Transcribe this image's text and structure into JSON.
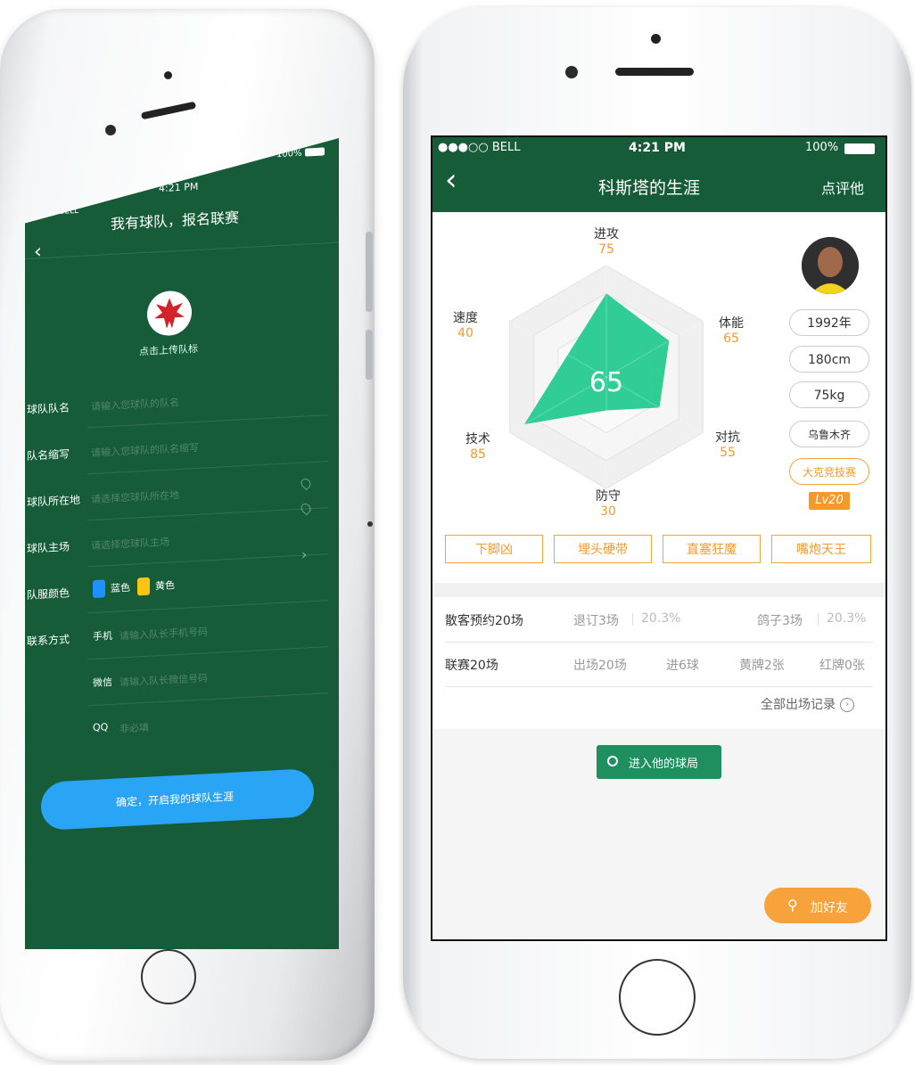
{
  "left_screen": {
    "status": {
      "carrier": "●●○○ BELL",
      "time": "4:21 PM",
      "battery": "100%"
    },
    "title": "我有球队，报名联赛",
    "back_icon": "chevron-left-icon",
    "upload_label": "点击上传队标",
    "fields": [
      {
        "label": "球队队名",
        "placeholder": "请输入您球队的队名"
      },
      {
        "label": "队名缩写",
        "placeholder": "请输入您球队的队名缩写"
      },
      {
        "label": "球队所在地",
        "placeholder": "请选择您球队所在地"
      },
      {
        "label": "球队主场",
        "placeholder": "请选择您球队主场"
      }
    ],
    "colors": {
      "label": "队服颜色",
      "blue": "蓝色",
      "yellow": "黄色",
      "blue_hex": "#1e90ff",
      "yellow_hex": "#ffc414"
    },
    "contact": {
      "label": "联系方式",
      "phone_label": "手机",
      "phone_placeholder": "请输入队长手机号码",
      "wechat_label": "微信",
      "wechat_placeholder": "请输入队长微信号码",
      "qq_label": "QQ",
      "qq_placeholder": "非必填"
    },
    "submit": "确定，开启我的球队生涯",
    "submit_color": "#2aa4f4"
  },
  "right_screen": {
    "status": {
      "carrier": "●●●○○ BELL",
      "time": "4:21 PM",
      "battery": "100%"
    },
    "title": "科斯塔的生涯",
    "action": "点评他",
    "radar": {
      "score": "65",
      "attributes": [
        {
          "name": "进攻",
          "value": "75"
        },
        {
          "name": "体能",
          "value": "65"
        },
        {
          "name": "对抗",
          "value": "55"
        },
        {
          "name": "防守",
          "value": "30"
        },
        {
          "name": "技术",
          "value": "85"
        },
        {
          "name": "速度",
          "value": "40"
        }
      ]
    },
    "profile": {
      "year": "1992年",
      "height": "180cm",
      "weight": "75kg",
      "city": "乌鲁木齐",
      "badge": "大克竞技赛",
      "level": "Lv20"
    },
    "tags": [
      "下脚凶",
      "埋头硬带",
      "直塞狂魔",
      "嘴炮天王"
    ],
    "stats": {
      "row1_title": "散客预约20场",
      "row1_a": "退订3场",
      "row1_a_pct": "20.3%",
      "row1_b": "鸽子3场",
      "row1_b_pct": "20.3%",
      "row2_title": "联赛20场",
      "row2_items": [
        "出场20场",
        "进6球",
        "黄牌2张",
        "红牌0张"
      ]
    },
    "all_records": "全部出场记录",
    "enter_button": "进入他的球局",
    "add_friend": "加好友",
    "colors": {
      "header": "#165c38",
      "accent": "#f29a2c",
      "radar_fill": "#1ec98e",
      "enter": "#1f8f5f"
    }
  }
}
